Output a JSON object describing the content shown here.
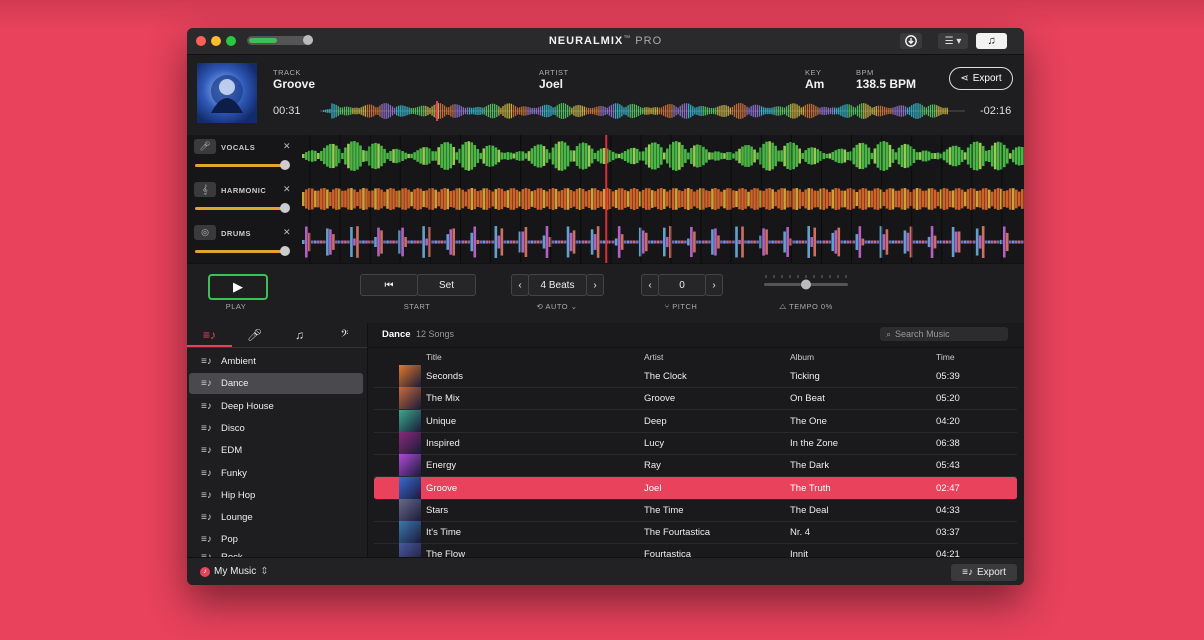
{
  "app": {
    "title_bold": "NEURALMIX",
    "title_tm": "™",
    "title_suffix": "PRO",
    "volume_fraction": 0.45
  },
  "toolbar": {
    "download_icon": "download-icon",
    "menu_icon": "list-menu-icon",
    "music_icon": "music-note-icon"
  },
  "track": {
    "track_label": "TRACK",
    "track_value": "Groove",
    "artist_label": "ARTIST",
    "artist_value": "Joel",
    "key_label": "KEY",
    "key_value": "Am",
    "bpm_label": "BPM",
    "bpm_value": "138.5 BPM",
    "export_label": "Export",
    "elapsed": "00:31",
    "remaining": "-02:16",
    "playhead_fraction": 0.18
  },
  "stems": [
    {
      "name": "VOCALS",
      "icon": "microphone-icon",
      "level": 0.95,
      "color": "#4fc84a"
    },
    {
      "name": "HARMONIC",
      "icon": "piano-icon",
      "level": 0.95,
      "color": "#e26a2c"
    },
    {
      "name": "DRUMS",
      "icon": "drum-icon",
      "level": 0.95,
      "color": "#8a6fd6"
    }
  ],
  "controls": {
    "play_label": "PLAY",
    "set_label": "Set",
    "start_label": "START",
    "beats_value": "4 Beats",
    "auto_label": "AUTO",
    "pitch_value": "0",
    "pitch_label": "PITCH",
    "tempo_label": "TEMPO 0%",
    "tempo_fraction": 0.5
  },
  "sidebar": {
    "tabs": [
      {
        "icon": "playlist-icon",
        "active": true
      },
      {
        "icon": "microphone-icon",
        "active": false
      },
      {
        "icon": "music-note-icon",
        "active": false
      },
      {
        "icon": "instruments-icon",
        "active": false
      }
    ],
    "genres": [
      "Ambient",
      "Dance",
      "Deep House",
      "Disco",
      "EDM",
      "Funky",
      "Hip Hop",
      "Lounge",
      "Pop",
      "Rock"
    ],
    "selected_index": 1,
    "source_label": "My Music"
  },
  "library": {
    "playlist_name": "Dance",
    "song_count": "12 Songs",
    "search_placeholder": "Search Music",
    "columns": [
      "Title",
      "Artist",
      "Album",
      "Time"
    ],
    "rows": [
      {
        "title": "Seconds",
        "artist": "The Clock",
        "album": "Ticking",
        "time": "05:39",
        "thumb": "#e07a2a"
      },
      {
        "title": "The Mix",
        "artist": "Groove",
        "album": "On Beat",
        "time": "05:20",
        "thumb": "#c86a3a"
      },
      {
        "title": "Unique",
        "artist": "Deep",
        "album": "The One",
        "time": "04:20",
        "thumb": "#3aa88a"
      },
      {
        "title": "Inspired",
        "artist": "Lucy",
        "album": "In the Zone",
        "time": "06:38",
        "thumb": "#8a2a7a"
      },
      {
        "title": "Energy",
        "artist": "Ray",
        "album": "The Dark",
        "time": "05:43",
        "thumb": "#b04ad6"
      },
      {
        "title": "Groove",
        "artist": "Joel",
        "album": "The Truth",
        "time": "02:47",
        "thumb": "#3a6ad0"
      },
      {
        "title": "Stars",
        "artist": "The Time",
        "album": "The Deal",
        "time": "04:33",
        "thumb": "#6a6a8a"
      },
      {
        "title": "It's Time",
        "artist": "The Fourtastica",
        "album": "Nr. 4",
        "time": "03:37",
        "thumb": "#3a7ab0"
      },
      {
        "title": "The Flow",
        "artist": "Fourtastica",
        "album": "Innit",
        "time": "04:21",
        "thumb": "#4a5aa0"
      }
    ],
    "selected_index": 5
  },
  "footer": {
    "export_label": "Export"
  }
}
